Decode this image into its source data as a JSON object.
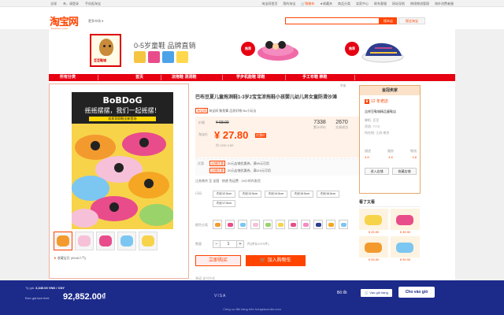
{
  "topbar": {
    "region": "全球",
    "login": "亲，请登录",
    "mobile": "手机逛淘宝",
    "right_links": [
      "淘宝网首页",
      "我的淘宝",
      "购物车",
      "收藏夹",
      "商品分类",
      "卖家中心",
      "联系客服",
      "网站导航"
    ],
    "cart_label": "购物车",
    "fav_label": "收藏夹",
    "ext": [
      "跨境物流管理",
      "海外消费者服"
    ]
  },
  "header": {
    "logo_cn": "淘宝网",
    "logo_en": "Taobao.com",
    "market_label": "更多市场",
    "search_btn": "搜本店",
    "search_btn2": "搜全淘宝"
  },
  "banner": {
    "shop_tag": "豆豆鞋城",
    "slogan": "0-5岁童鞋 品牌直销",
    "hot1": "推荐",
    "hot2": "推荐",
    "colors": {
      "accent": "#e60012"
    }
  },
  "nav": {
    "items": [
      "所有分类",
      "首页",
      "凉拖鞋  洞洞鞋",
      "学步机能鞋  球鞋",
      "手工布鞋  棉鞋"
    ],
    "report": "举报"
  },
  "product": {
    "img_title": "BoBDoG",
    "img_sub": "摇摇摆摆，我们一起摇摆！",
    "img_banner": "软质洞洞鞋全新登场",
    "title": "巴布豆夏儿童拖洞鞋1-3岁2宝宝凉拖鞋小孩婴儿幼儿男女童防滑沙滩",
    "badges": "淘宝网  聚划算  品质好物  Bo小玩法",
    "tb_badge": "淘宝网",
    "price_label": "价格",
    "orig_price": "¥ 68.00",
    "tb_price_label": "淘宝价",
    "price": "¥ 27.80",
    "price_tag": "优惠价",
    "usd": "约 USD 3.89",
    "stats": [
      {
        "value": "7338",
        "label": "累计评价"
      },
      {
        "value": "2670",
        "label": "交易成功"
      }
    ],
    "promo_label": "优惠",
    "promos": [
      {
        "tag": "店铺优惠",
        "text": "20元店铺优惠券，满99元可用"
      },
      {
        "tag": "店铺优惠",
        "text": "20元店铺优惠券，满119元可用"
      }
    ],
    "ship": "江苏南京 至 全国 · 快递 免运费 · 24小时内发货",
    "size_label": "尺码",
    "sizes": [
      "内长12.5cm",
      "内长13.5cm",
      "内长14.5cm",
      "内长15.5cm",
      "内长16.5cm",
      "内长17.5cm"
    ],
    "color_label": "颜色分类",
    "qty_label": "数量",
    "qty": "1",
    "stock": "件(库存1979件)",
    "buy_now": "立即购买",
    "add_cart": "加入购物车",
    "promise": "承诺  支付方式",
    "fav_text": "收藏宝贝 (6546人气)"
  },
  "seller": {
    "head": "金冠卖家",
    "years": "12 年老店",
    "name": "吉祥豆鞋城精品童鞋店",
    "info": [
      "掌柜: 豆豆",
      "资质: 7770",
      "所在地: 江苏 南京"
    ],
    "score_labels": [
      "描述",
      "服务",
      "物流"
    ],
    "score_vals": [
      "4.8",
      "4.8",
      "4.8"
    ],
    "btn1": "进入店铺",
    "btn2": "收藏店铺"
  },
  "related": {
    "head": "看了又看",
    "prices": [
      "¥ 25.90",
      "¥ 35.90",
      "¥ 26.90",
      "¥ 39.90"
    ]
  },
  "overlay": {
    "rate_label": "Tỷ giá:",
    "rate_value": "3,340.00 VND / CNY",
    "total_label": "Đơn giá tạm thời:",
    "total": "92,852.00₫",
    "pay": "VISA",
    "skip": "Bỏ lỗi",
    "add": "Vào giỏ hàng",
    "order": "Cho vào giỏ",
    "footer": "Công cụ đặt hàng trên hongkacorder.com"
  }
}
